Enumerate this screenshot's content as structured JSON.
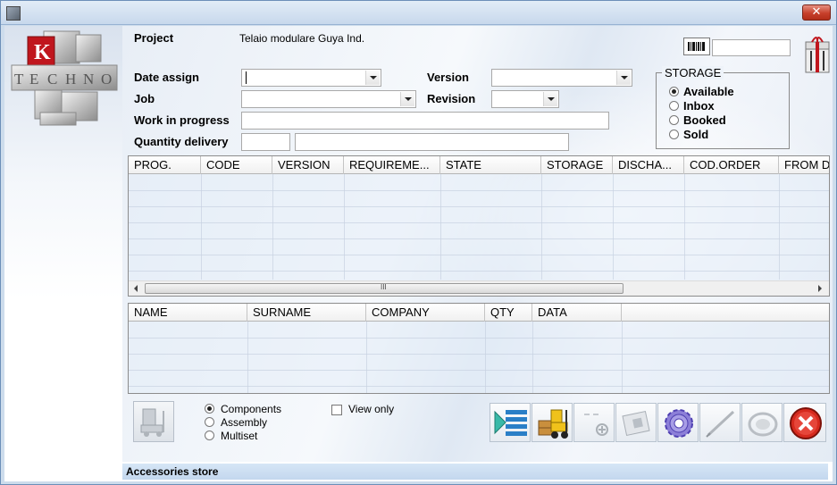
{
  "header": {
    "project_label": "Project",
    "project_value": "Telaio modulare Guya Ind."
  },
  "logo": {
    "letters": [
      "K",
      "T",
      "E",
      "C",
      "H",
      "N",
      "O"
    ]
  },
  "form": {
    "date_assign_label": "Date assign",
    "version_label": "Version",
    "job_label": "Job",
    "revision_label": "Revision",
    "wip_label": "Work in progress",
    "qty_label": "Quantity delivery"
  },
  "storage": {
    "title": "STORAGE",
    "options": [
      {
        "label": "Available",
        "selected": true
      },
      {
        "label": "Inbox",
        "selected": false
      },
      {
        "label": "Booked",
        "selected": false
      },
      {
        "label": "Sold",
        "selected": false
      }
    ]
  },
  "grid1": {
    "columns": [
      "PROG.",
      "CODE",
      "VERSION",
      "REQUIREME...",
      "STATE",
      "STORAGE",
      "DISCHA...",
      "COD.ORDER",
      "FROM D"
    ],
    "scroll_grip": "III"
  },
  "grid2": {
    "columns": [
      "NAME",
      "SURNAME",
      "COMPANY",
      "QTY",
      "DATA"
    ]
  },
  "bottom": {
    "type_options": [
      {
        "label": "Components",
        "selected": true
      },
      {
        "label": "Assembly",
        "selected": false
      },
      {
        "label": "Multiset",
        "selected": false
      }
    ],
    "view_only_label": "View only",
    "view_only_checked": false
  },
  "status": {
    "text": "Accessories store"
  },
  "colors": {
    "close_red": "#c7402b",
    "logo_red": "#c0161d",
    "status_strip": "#c9dbef"
  }
}
